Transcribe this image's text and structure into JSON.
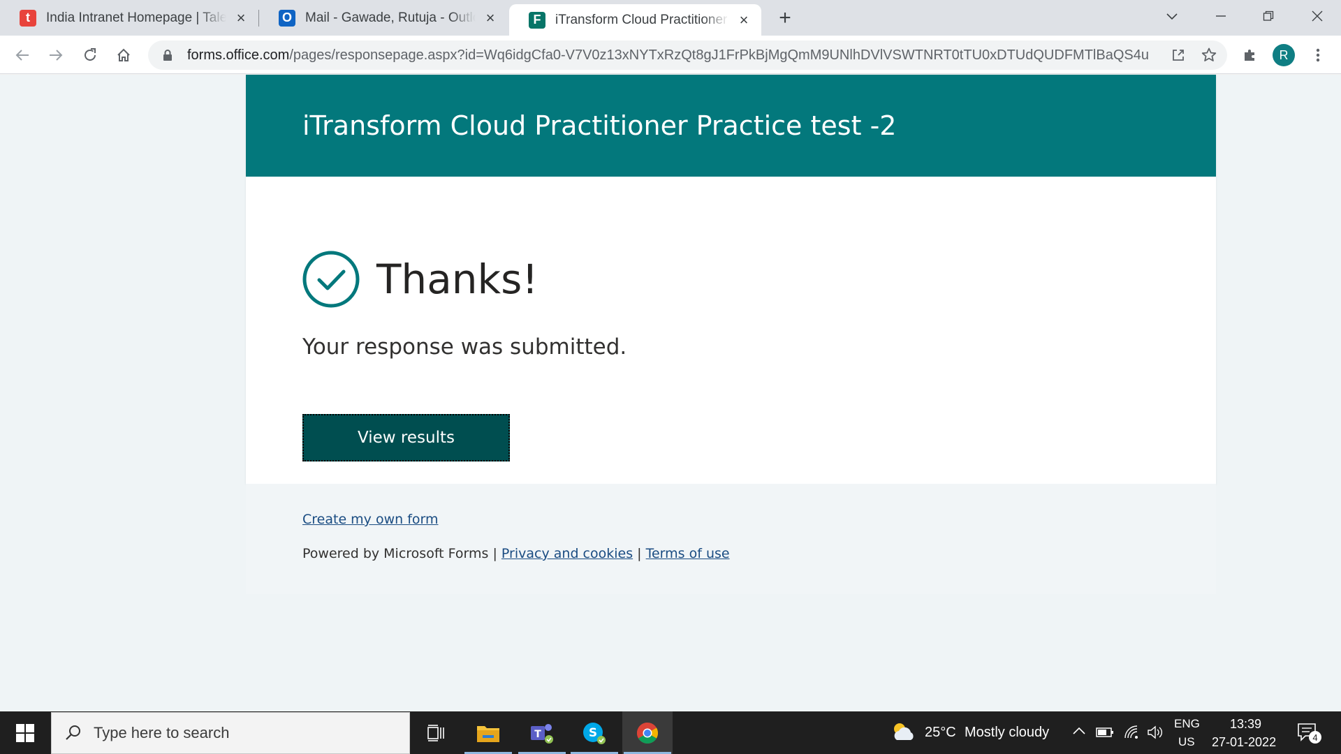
{
  "browser": {
    "tabs": [
      {
        "title": "India Intranet Homepage | Talent",
        "favicon_letter": "t",
        "favicon_color": "#e8433c"
      },
      {
        "title": "Mail - Gawade, Rutuja - Outlook",
        "favicon_letter": "O",
        "favicon_color": "#0f64c4"
      },
      {
        "title": "iTransform Cloud Practitioner Pra",
        "favicon_letter": "F",
        "favicon_color": "#077568",
        "active": true
      }
    ],
    "url_host": "forms.office.com",
    "url_path": "/pages/responsepage.aspx?id=Wq6idgCfa0-V7V0z13xNYTxRzQt8gJ1FrPkBjMgQmM9UNlhDVlVSWTNRT0tTU0xDTUdQUDFMTlBaQS4u",
    "profile_initial": "R"
  },
  "form": {
    "title": "iTransform Cloud Practitioner Practice test -2",
    "thanks": "Thanks!",
    "message": "Your response was submitted.",
    "view_results_label": "View results",
    "accent_color": "#03787c"
  },
  "footer": {
    "create_link": "Create my own form",
    "powered_by": "Powered by Microsoft Forms |",
    "privacy_link": "Privacy and cookies",
    "separator": "|",
    "terms_link": "Terms of use"
  },
  "taskbar": {
    "search_placeholder": "Type here to search",
    "weather_temp": "25°C",
    "weather_desc": "Mostly cloudy",
    "lang_top": "ENG",
    "lang_bottom": "US",
    "time": "13:39",
    "date": "27-01-2022",
    "notification_count": "4"
  }
}
